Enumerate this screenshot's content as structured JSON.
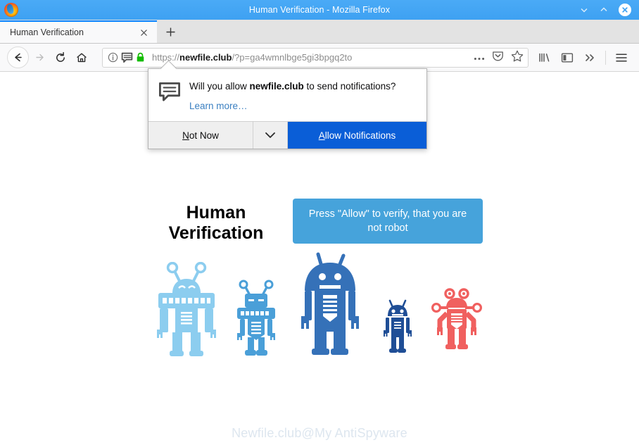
{
  "window": {
    "title": "Human Verification - Mozilla Firefox",
    "logo_icon": "firefox-logo",
    "minimize_icon": "chevron-down-icon",
    "maximize_icon": "chevron-up-icon",
    "close_icon": "close-icon",
    "titlebar_color": "#42a5f5"
  },
  "tabs": {
    "items": [
      {
        "title": "Human Verification",
        "close_icon": "close-icon",
        "active": true
      }
    ],
    "new_tab_icon": "plus-icon",
    "active_indicator_color": "#0a84ff"
  },
  "toolbar": {
    "back_icon": "arrow-left-icon",
    "forward_icon": "arrow-right-icon",
    "reload_icon": "reload-icon",
    "home_icon": "home-icon",
    "library_icon": "library-icon",
    "sidebar_icon": "sidebar-icon",
    "overflow_icon": "double-chevron-right-icon",
    "menu_icon": "hamburger-menu-icon"
  },
  "urlbar": {
    "identity_icon": "info-circle-icon",
    "notification_icon": "speech-bubble-icon",
    "lock_icon": "padlock-icon",
    "lock_color": "#12bc00",
    "url_prefix": "https://",
    "url_host": "newfile.club",
    "url_path": "/?p=ga4wmnlbge5gi3bpgq2to",
    "page_actions_icon": "ellipsis-icon",
    "pocket_icon": "pocket-icon",
    "bookmark_icon": "star-icon"
  },
  "doorhanger": {
    "icon": "speech-bubble-icon",
    "message_prefix": "Will you allow ",
    "message_host": "newfile.club",
    "message_suffix": " to send notifications?",
    "learn_more": "Learn more…",
    "secondary_button": "Not Now",
    "secondary_accesskey": "N",
    "dropdown_icon": "chevron-down-icon",
    "primary_button": "Allow Notifications",
    "primary_accesskey": "A",
    "primary_color": "#0a5ed7"
  },
  "page": {
    "headline": "Human Verification",
    "verify_text": "Press \"Allow\" to verify, that you are not robot",
    "verify_color": "#46a3db",
    "watermark": "Newfile.club@My AntiSpyware",
    "robots": [
      {
        "name": "robot-light-blue",
        "color": "#8ccdef"
      },
      {
        "name": "robot-medium-blue",
        "color": "#4a9fd8"
      },
      {
        "name": "robot-blue-large",
        "color": "#3571b8"
      },
      {
        "name": "robot-navy-small",
        "color": "#1f4e96"
      },
      {
        "name": "robot-red",
        "color": "#f0605f"
      }
    ]
  }
}
